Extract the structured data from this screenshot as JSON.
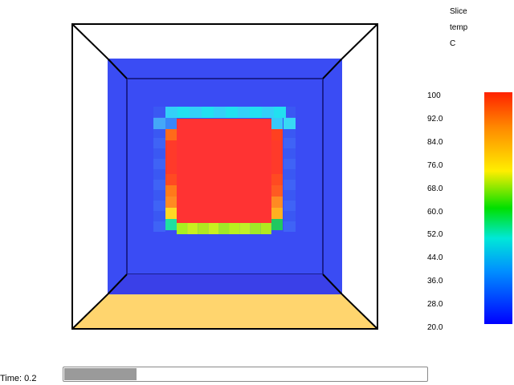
{
  "info": {
    "line1": "Slice",
    "line2": "temp",
    "line3": "C"
  },
  "colorbar": {
    "labels": [
      "100",
      "92.0",
      "84.0",
      "76.0",
      "68.0",
      "60.0",
      "52.0",
      "44.0",
      "36.0",
      "28.0",
      "20.0"
    ],
    "min": 20.0,
    "max": 100.0,
    "colors": [
      "#ff2200",
      "#ff8800",
      "#ffee00",
      "#00e000",
      "#00e8d8",
      "#0090ff",
      "#0000ff"
    ]
  },
  "time": {
    "label": "Time: 0.2",
    "progress": 0.2
  },
  "colors": {
    "outer_wall": "#3a4cf4",
    "floor": "#ffd56e",
    "hot_core": "#ff3333",
    "frame": "#000000"
  }
}
